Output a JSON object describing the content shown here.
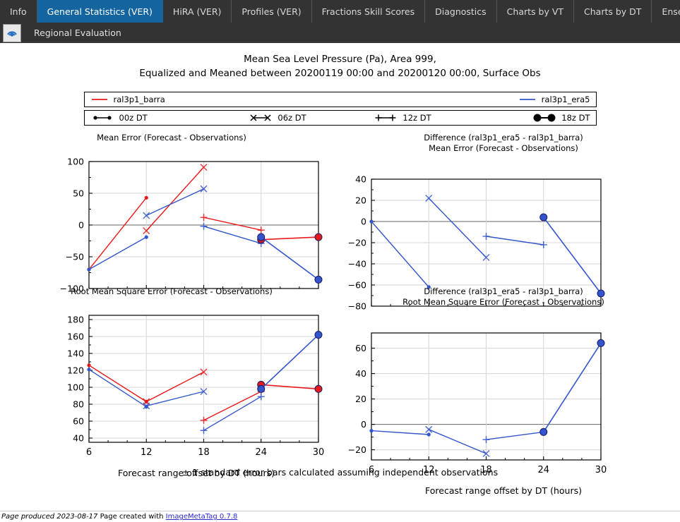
{
  "tabs": [
    {
      "label": "Info",
      "active": false
    },
    {
      "label": "General Statistics (VER)",
      "active": true
    },
    {
      "label": "HiRA (VER)",
      "active": false
    },
    {
      "label": "Profiles (VER)",
      "active": false
    },
    {
      "label": "Fractions Skill Scores",
      "active": false
    },
    {
      "label": "Diagnostics",
      "active": false
    },
    {
      "label": "Charts by VT",
      "active": false
    },
    {
      "label": "Charts by DT",
      "active": false
    },
    {
      "label": "Ense",
      "active": false
    }
  ],
  "header": {
    "logo_icon": "radar-signal-icon",
    "title": "Regional Evaluation"
  },
  "title": {
    "line1": "Mean Sea Level Pressure (Pa), Area 999,",
    "line2": "Equalized and Meaned between 20200119 00:00 and 20200120 00:00, Surface Obs"
  },
  "legend_models": [
    {
      "label": "ral3p1_barra",
      "color": "#e8191b"
    },
    {
      "label": "ral3p1_era5",
      "color": "#3355cc"
    }
  ],
  "legend_dt": [
    {
      "label": "00z DT",
      "marker": "dot"
    },
    {
      "label": "06z DT",
      "marker": "x"
    },
    {
      "label": "12z DT",
      "marker": "plus"
    },
    {
      "label": "18z DT",
      "marker": "bigdot"
    }
  ],
  "footnote": "± 1 standard error bars calculated assuming independent observations",
  "footer": {
    "produced": "Page produced 2023-08-17",
    "created_with": "Page created with",
    "link": "ImageMetaTag 0.7.8"
  },
  "colors": {
    "red": "#e8191b",
    "blue": "#3355cc",
    "tab_active": "#1464a0",
    "chrome": "#333333"
  },
  "chart_data": [
    {
      "id": "mean-error",
      "type": "line",
      "title": "Mean Error (Forecast - Observations)",
      "xlabel": "Forecast range offset by DT (hours)",
      "ylabel": "",
      "xlim": [
        6,
        30
      ],
      "ylim": [
        -100,
        100
      ],
      "xticks": [
        6,
        12,
        18,
        24,
        30
      ],
      "yticks": [
        -100,
        -50,
        0,
        50,
        100
      ],
      "grid": true,
      "series": [
        {
          "name": "ral3p1_barra 00z DT",
          "color": "#e8191b",
          "marker": "dot",
          "x": [
            6,
            12
          ],
          "values": [
            -70,
            43
          ]
        },
        {
          "name": "ral3p1_era5 00z DT",
          "color": "#3355cc",
          "marker": "dot",
          "x": [
            6,
            12
          ],
          "values": [
            -70,
            -19
          ]
        },
        {
          "name": "ral3p1_barra 06z DT",
          "color": "#e8191b",
          "marker": "x",
          "x": [
            12,
            18
          ],
          "values": [
            -9,
            91
          ]
        },
        {
          "name": "ral3p1_era5 06z DT",
          "color": "#3355cc",
          "marker": "x",
          "x": [
            12,
            18
          ],
          "values": [
            15,
            57
          ]
        },
        {
          "name": "ral3p1_barra 12z DT",
          "color": "#e8191b",
          "marker": "plus",
          "x": [
            18,
            24
          ],
          "values": [
            12,
            -8
          ]
        },
        {
          "name": "ral3p1_era5 12z DT",
          "color": "#3355cc",
          "marker": "plus",
          "x": [
            18,
            24
          ],
          "values": [
            -2,
            -29
          ]
        },
        {
          "name": "ral3p1_barra 18z DT",
          "color": "#e8191b",
          "marker": "bigdot",
          "x": [
            24,
            30
          ],
          "values": [
            -23,
            -19
          ]
        },
        {
          "name": "ral3p1_era5 18z DT",
          "color": "#3355cc",
          "marker": "bigdot",
          "x": [
            24,
            30
          ],
          "values": [
            -19,
            -86
          ]
        }
      ]
    },
    {
      "id": "mean-error-difference",
      "type": "line",
      "title_line1": "Difference (ral3p1_era5 - ral3p1_barra)",
      "title_line2": "Mean Error (Forecast - Observations)",
      "xlabel": "Forecast range offset by DT (hours)",
      "ylabel": "",
      "xlim": [
        6,
        30
      ],
      "ylim": [
        -80,
        40
      ],
      "xticks": [
        6,
        12,
        18,
        24,
        30
      ],
      "yticks": [
        -80,
        -60,
        -40,
        -20,
        0,
        20,
        40
      ],
      "grid": true,
      "series": [
        {
          "name": "00z DT",
          "color": "#3355cc",
          "marker": "dot",
          "x": [
            6,
            12
          ],
          "values": [
            0,
            -62
          ]
        },
        {
          "name": "06z DT",
          "color": "#3355cc",
          "marker": "x",
          "x": [
            12,
            18
          ],
          "values": [
            22,
            -34
          ]
        },
        {
          "name": "12z DT",
          "color": "#3355cc",
          "marker": "plus",
          "x": [
            18,
            24
          ],
          "values": [
            -14,
            -22
          ]
        },
        {
          "name": "18z DT",
          "color": "#3355cc",
          "marker": "bigdot",
          "x": [
            24,
            30
          ],
          "values": [
            4,
            -68
          ]
        }
      ]
    },
    {
      "id": "rmse",
      "type": "line",
      "title": "Root Mean Square Error (Forecast - Observations)",
      "xlabel": "Forecast range offset by DT (hours)",
      "ylabel": "",
      "xlim": [
        6,
        30
      ],
      "ylim": [
        35,
        185
      ],
      "xticks": [
        6,
        12,
        18,
        24,
        30
      ],
      "yticks": [
        40,
        60,
        80,
        100,
        120,
        140,
        160,
        180
      ],
      "grid": true,
      "series": [
        {
          "name": "ral3p1_barra 00z DT",
          "color": "#e8191b",
          "marker": "dot",
          "x": [
            6,
            12
          ],
          "values": [
            126,
            83
          ]
        },
        {
          "name": "ral3p1_era5 00z DT",
          "color": "#3355cc",
          "marker": "dot",
          "x": [
            6,
            12
          ],
          "values": [
            121,
            77
          ]
        },
        {
          "name": "ral3p1_barra 06z DT",
          "color": "#e8191b",
          "marker": "x",
          "x": [
            12,
            18
          ],
          "values": [
            83,
            118
          ]
        },
        {
          "name": "ral3p1_era5 06z DT",
          "color": "#3355cc",
          "marker": "x",
          "x": [
            12,
            18
          ],
          "values": [
            78,
            95
          ]
        },
        {
          "name": "ral3p1_barra 12z DT",
          "color": "#e8191b",
          "marker": "plus",
          "x": [
            18,
            24
          ],
          "values": [
            61,
            95
          ]
        },
        {
          "name": "ral3p1_era5 12z DT",
          "color": "#3355cc",
          "marker": "plus",
          "x": [
            18,
            24
          ],
          "values": [
            49,
            89
          ]
        },
        {
          "name": "ral3p1_barra 18z DT",
          "color": "#e8191b",
          "marker": "bigdot",
          "x": [
            24,
            30
          ],
          "values": [
            103,
            98
          ]
        },
        {
          "name": "ral3p1_era5 18z DT",
          "color": "#3355cc",
          "marker": "bigdot",
          "x": [
            24,
            30
          ],
          "values": [
            98,
            162
          ]
        }
      ]
    },
    {
      "id": "rmse-difference",
      "type": "line",
      "title_line1": "Difference (ral3p1_era5 - ral3p1_barra)",
      "title_line2": "Root Mean Square Error (Forecast - Observations)",
      "xlabel": "Forecast range offset by DT (hours)",
      "ylabel": "",
      "xlim": [
        6,
        30
      ],
      "ylim": [
        -28,
        72
      ],
      "xticks": [
        6,
        12,
        18,
        24,
        30
      ],
      "yticks": [
        -20,
        0,
        20,
        40,
        60
      ],
      "grid": true,
      "series": [
        {
          "name": "00z DT",
          "color": "#3355cc",
          "marker": "dot",
          "x": [
            6,
            12
          ],
          "values": [
            -5,
            -8
          ]
        },
        {
          "name": "06z DT",
          "color": "#3355cc",
          "marker": "x",
          "x": [
            12,
            18
          ],
          "values": [
            -4,
            -23
          ]
        },
        {
          "name": "12z DT",
          "color": "#3355cc",
          "marker": "plus",
          "x": [
            18,
            24
          ],
          "values": [
            -12,
            -6
          ]
        },
        {
          "name": "18z DT",
          "color": "#3355cc",
          "marker": "bigdot",
          "x": [
            24,
            30
          ],
          "values": [
            -6,
            64
          ]
        }
      ]
    }
  ]
}
